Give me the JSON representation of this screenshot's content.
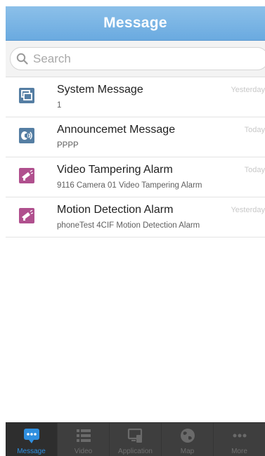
{
  "header": {
    "title": "Message"
  },
  "search": {
    "placeholder": "Search"
  },
  "messages": [
    {
      "title": "System Message",
      "subtitle": "1",
      "time": "Yesterday",
      "icon": "system-message-icon"
    },
    {
      "title": "Announcemet Message",
      "subtitle": "PPPP",
      "time": "Today",
      "icon": "announcement-icon"
    },
    {
      "title": "Video Tampering Alarm",
      "subtitle": "9116 Camera 01 Video Tampering Alarm",
      "time": "Today",
      "icon": "alarm-camera-icon"
    },
    {
      "title": "Motion Detection Alarm",
      "subtitle": "phoneTest 4CIF Motion Detection Alarm",
      "time": "Yesterday",
      "icon": "alarm-camera-icon"
    }
  ],
  "tabs": [
    {
      "label": "Message",
      "icon": "message-bubble-icon",
      "active": true
    },
    {
      "label": "Video",
      "icon": "video-list-icon",
      "active": false
    },
    {
      "label": "Application",
      "icon": "application-icon",
      "active": false
    },
    {
      "label": "Map",
      "icon": "globe-icon",
      "active": false
    },
    {
      "label": "More",
      "icon": "more-dots-icon",
      "active": false
    }
  ],
  "colors": {
    "header": "#7ab4e6",
    "tab_active": "#2f8fe0",
    "tab_bar": "#3e3e3e",
    "system_icon_bg": "#557ea3",
    "alarm_icon_bg": "#b0508e"
  }
}
